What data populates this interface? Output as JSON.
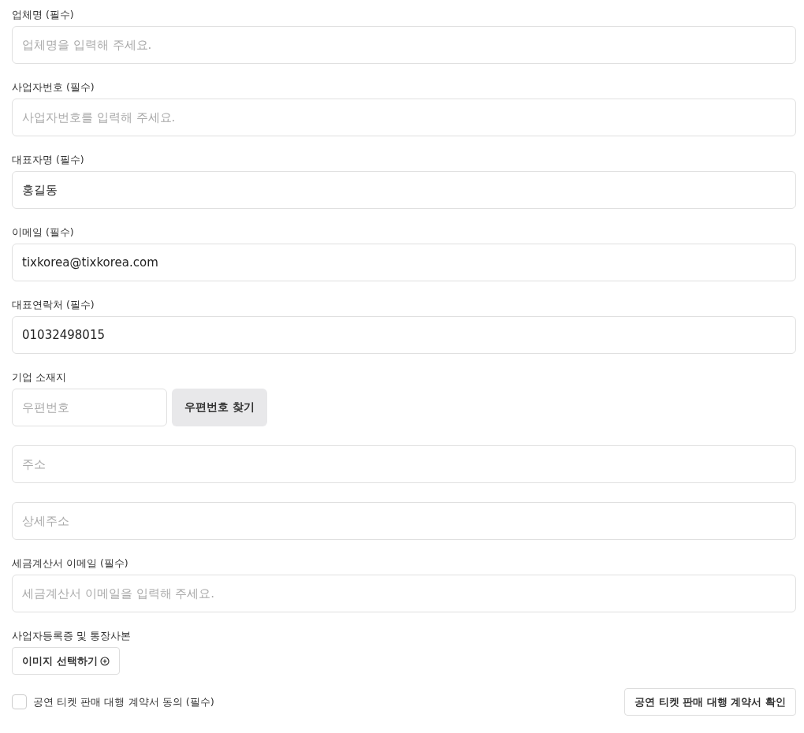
{
  "fields": [
    {
      "kind": "text",
      "label": "업체명 (필수)",
      "placeholder": "업체명을 입력해 주세요."
    },
    {
      "kind": "text",
      "label": "사업자번호 (필수)",
      "placeholder": "사업자번호를 입력해 주세요."
    },
    {
      "kind": "text",
      "label": "대표자명 (필수)",
      "value": "홍길동"
    },
    {
      "kind": "text",
      "label": "이메일 (필수)",
      "value": "tixkorea@tixkorea.com"
    },
    {
      "kind": "text",
      "label": "대표연락처 (필수)",
      "value": "01032498015"
    },
    {
      "kind": "address",
      "label": "기업 소재지",
      "zip_placeholder": "우편번호",
      "zip_button": "우편번호 찾기",
      "address_placeholder": "주소",
      "detail_placeholder": "상세주소"
    },
    {
      "kind": "text",
      "label": "세금계산서 이메일 (필수)",
      "placeholder": "세금계산서 이메일을 입력해 주세요."
    },
    {
      "kind": "file",
      "label": "사업자등록증 및 통장사본",
      "button": "이미지 선택하기"
    }
  ],
  "agreement": {
    "label": "공연 티켓 판매 대행 계약서 동의 (필수)",
    "checked": false,
    "button": "공연 티켓 판매 대행 계약서 확인"
  }
}
